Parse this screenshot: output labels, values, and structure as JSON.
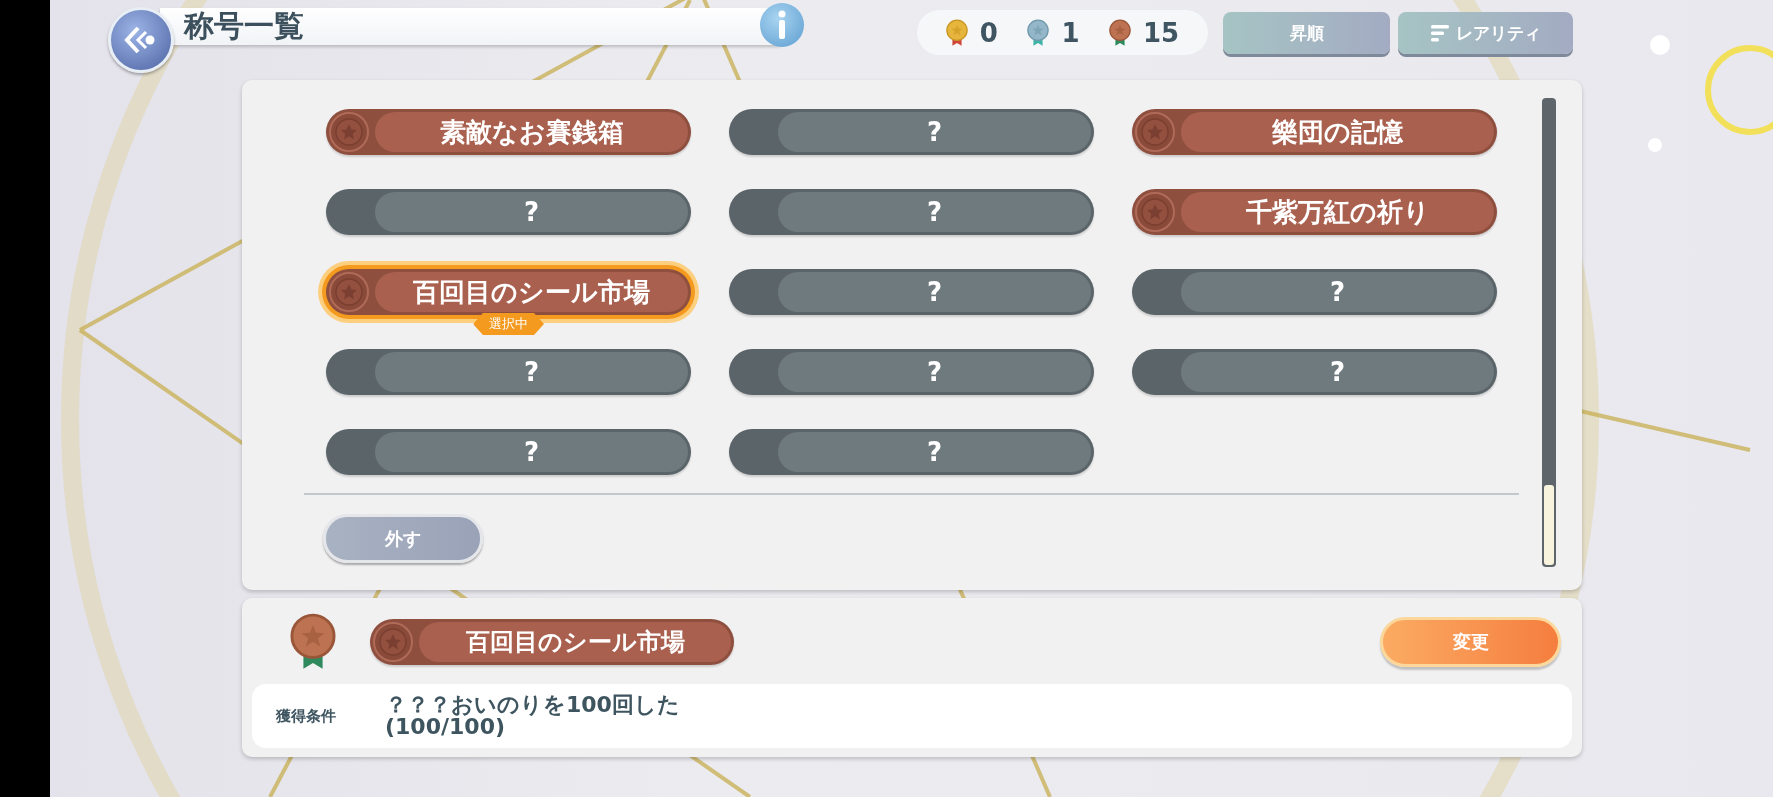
{
  "header": {
    "title": "称号一覧"
  },
  "medal_counts": [
    {
      "kind": "gold",
      "count": "0"
    },
    {
      "kind": "silver",
      "count": "1"
    },
    {
      "kind": "bronze",
      "count": "15"
    }
  ],
  "sort_buttons": [
    {
      "kind": "plain",
      "label": "昇順"
    },
    {
      "kind": "filter",
      "label": "レアリティ"
    }
  ],
  "titles": [
    {
      "kind": "bronze",
      "label": "素敵なお賽銭箱",
      "selected": false
    },
    {
      "kind": "locked",
      "label": "?",
      "selected": false
    },
    {
      "kind": "bronze",
      "label": "樂団の記憶",
      "selected": false
    },
    {
      "kind": "locked",
      "label": "?",
      "selected": false
    },
    {
      "kind": "locked",
      "label": "?",
      "selected": false
    },
    {
      "kind": "bronze",
      "label": "千紫万紅の祈り",
      "selected": false
    },
    {
      "kind": "bronze",
      "label": "百回目のシール市場",
      "selected": true,
      "badge": "選択中"
    },
    {
      "kind": "locked",
      "label": "?",
      "selected": false
    },
    {
      "kind": "locked",
      "label": "?",
      "selected": false
    },
    {
      "kind": "locked",
      "label": "?",
      "selected": false
    },
    {
      "kind": "locked",
      "label": "?",
      "selected": false
    },
    {
      "kind": "locked",
      "label": "?",
      "selected": false
    },
    {
      "kind": "locked",
      "label": "?",
      "selected": false
    },
    {
      "kind": "locked",
      "label": "?",
      "selected": false
    }
  ],
  "remove_button": "外す",
  "detail": {
    "medal": {
      "kind": "bronze"
    },
    "title": {
      "kind": "bronze",
      "label": "百回目のシール市場"
    },
    "change_button": "変更",
    "condition_label": "獲得条件",
    "condition_lines": [
      "？？？おいのりを100回した",
      "(100/100)"
    ]
  }
}
